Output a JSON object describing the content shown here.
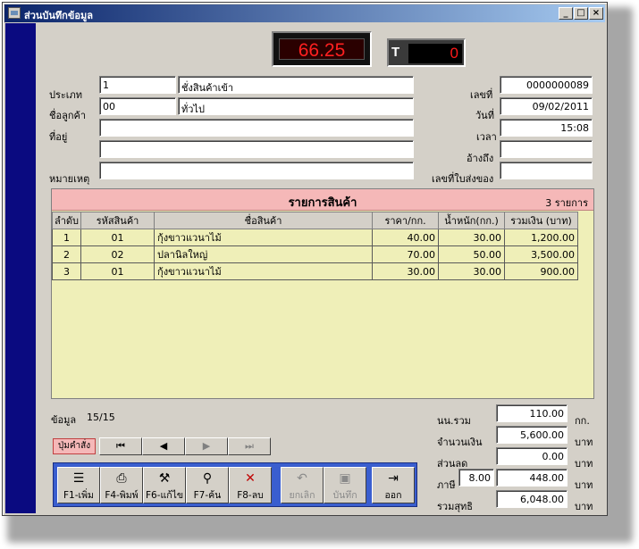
{
  "window": {
    "title": "ส่วนบันทึกข้อมูล",
    "minimize": "_",
    "maximize": "□",
    "close": "×"
  },
  "display": {
    "weight": "66.25",
    "t_label": "T",
    "t_value": "0"
  },
  "form": {
    "type_label": "ประเภท",
    "type_code": "1",
    "type_name": "ชั่งสินค้าเข้า",
    "customer_label": "ชื่อลูกค้า",
    "customer_code": "00",
    "customer_name": "ทั่วไป",
    "address_label": "ที่อยู่",
    "address1": "",
    "address2": "",
    "note_label": "หมายเหตุ",
    "note": "",
    "docno_label": "เลขที่",
    "docno": "0000000089",
    "date_label": "วันที่",
    "date": "09/02/2011",
    "time_label": "เวลา",
    "time": "15:08",
    "ref_label": "อ้างถึง",
    "ref": "",
    "delivery_label": "เลขที่ใบส่งของ",
    "delivery": ""
  },
  "items": {
    "title": "รายการสินค้า",
    "count": "3  รายการ",
    "columns": [
      "ลำดับ",
      "รหัสสินค้า",
      "ชื่อสินค้า",
      "ราคา/กก.",
      "น้ำหนัก(กก.)",
      "รวมเงิน (บาท)"
    ],
    "rows": [
      [
        "1",
        "01",
        "กุ้งขาวแวนาไม้",
        "40.00",
        "30.00",
        "1,200.00"
      ],
      [
        "2",
        "02",
        "ปลานิลใหญ่",
        "70.00",
        "50.00",
        "3,500.00"
      ],
      [
        "3",
        "01",
        "กุ้งขาวแวนาไม้",
        "30.00",
        "30.00",
        "900.00"
      ]
    ]
  },
  "status": {
    "label": "ข้อมูล",
    "record": "15/15"
  },
  "nav": {
    "label": "ปุ่มคำสั่ง",
    "first": "⏮",
    "prev": "◀",
    "next": "▶",
    "last": "⏭"
  },
  "commands": {
    "add": "F1-เพิ่ม",
    "print": "F4-พิมพ์",
    "edit": "F6-แก้ไข",
    "find": "F7-ค้น",
    "delete": "F8-ลบ",
    "cancel": "ยกเลิก",
    "save": "บันทึก",
    "exit": "ออก"
  },
  "icons": {
    "add": "list-icon",
    "print": "printer-icon",
    "edit": "wrench-icon",
    "find": "magnifier-icon",
    "delete": "x-icon",
    "cancel": "undo-icon",
    "save": "disk-icon",
    "exit": "door-icon"
  },
  "totals": {
    "weight_label": "นน.รวม",
    "weight": "110.00",
    "weight_unit": "กก.",
    "amount_label": "จำนวนเงิน",
    "amount": "5,600.00",
    "amount_unit": "บาท",
    "discount_label": "ส่วนลด",
    "discount": "0.00",
    "discount_unit": "บาท",
    "tax_label": "ภาษี",
    "tax_rate": "8.00",
    "tax": "448.00",
    "tax_unit": "บาท",
    "net_label": "รวมสุทธิ",
    "net": "6,048.00",
    "net_unit": "บาท"
  },
  "colors": {
    "accent": "#0a246a",
    "cmdbar": "#3a5ecf",
    "grid_bg": "#efefb8",
    "header_bg": "#f5b8b8",
    "display_red": "#ff2020"
  }
}
